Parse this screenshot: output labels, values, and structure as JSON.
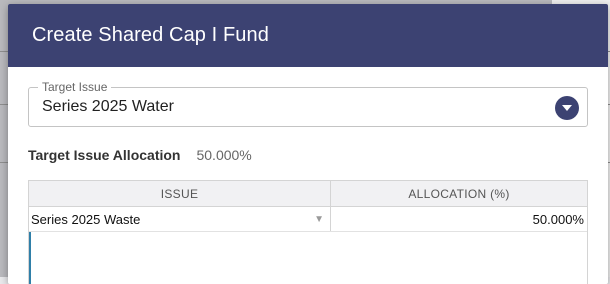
{
  "dialog": {
    "title": "Create Shared Cap I Fund"
  },
  "target_issue": {
    "label": "Target Issue",
    "value": "Series 2025 Water"
  },
  "allocation": {
    "label": "Target Issue Allocation",
    "value": "50.000%"
  },
  "grid": {
    "columns": [
      "ISSUE",
      "ALLOCATION (%)"
    ],
    "rows": [
      {
        "issue": "Series 2025 Waste",
        "allocation": "50.000%"
      }
    ]
  },
  "colors": {
    "header_bg": "#3c4272",
    "accent": "#3c4272",
    "active_edge": "#2f7fa8"
  },
  "icons": {
    "dropdown": "chevron-down-icon",
    "row_select": "caret-down-icon"
  }
}
